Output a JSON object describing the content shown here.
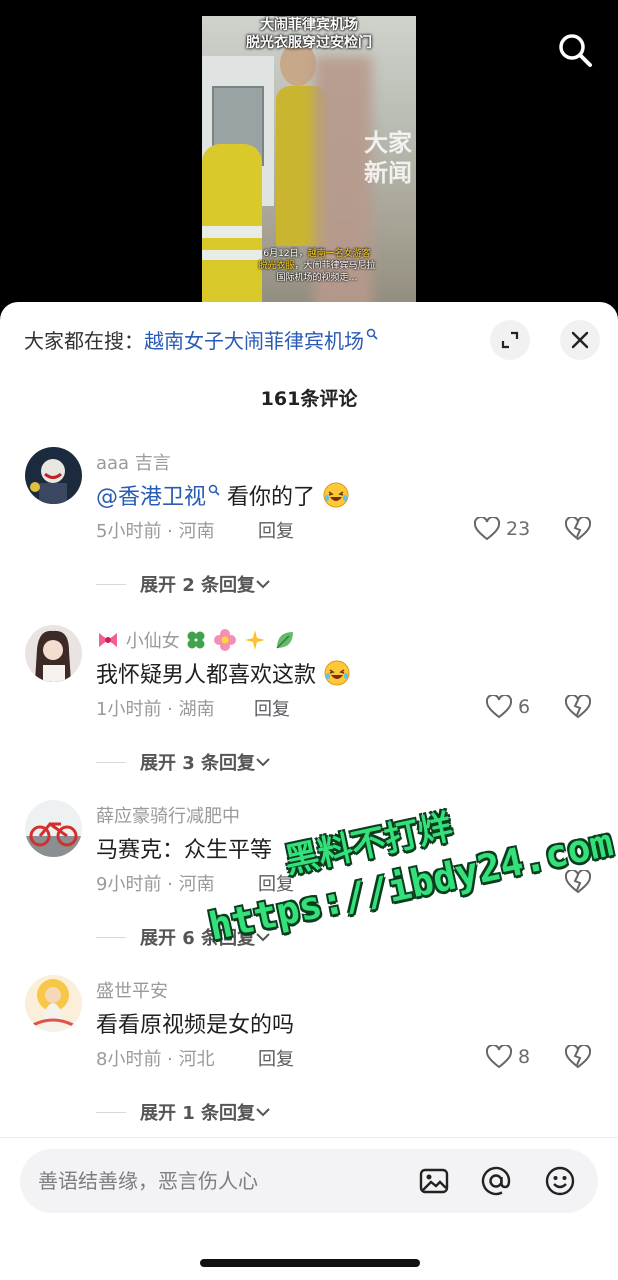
{
  "video": {
    "title_line1": "大闹菲律宾机场",
    "title_line2": "脱光衣服穿过安检门",
    "watermark_line1": "大家",
    "watermark_line2": "新闻",
    "caption_part1": "6月12日，",
    "caption_hl1": "越南一名女游客",
    "caption_hl2": "脱光衣服",
    "caption_part2": "，大闹菲律宾马尼拉",
    "caption_part3": "国际机场的视频走…"
  },
  "sheet": {
    "search_prefix": "大家都在搜：",
    "search_term": "越南女子大闹菲律宾机场",
    "comment_count": "161条评论"
  },
  "comments": [
    {
      "user": "aaa 吉言",
      "mention": "@香港卫视",
      "text": " 看你的了",
      "time_location": "5小时前 · 河南",
      "reply": "回复",
      "likes": "23",
      "expand": "展开 2 条回复"
    },
    {
      "user": "小仙女",
      "text": "我怀疑男人都喜欢这款",
      "time_location": "1小时前 · 湖南",
      "reply": "回复",
      "likes": "6",
      "expand": "展开 3 条回复"
    },
    {
      "user": "薛应豪骑行减肥中",
      "text": "马赛克：众生平等",
      "time_location": "9小时前 · 河南",
      "reply": "回复",
      "likes": "",
      "expand": "展开 6 条回复"
    },
    {
      "user": "盛世平安",
      "text": "看看原视频是女的吗",
      "time_location": "8小时前 · 河北",
      "reply": "回复",
      "likes": "8",
      "expand": "展开 1 条回复"
    }
  ],
  "overlay": {
    "line1": "黑料不打烊",
    "line2": "https://ibdy24.com"
  },
  "input": {
    "placeholder": "善语结善缘，恶言伤人心"
  },
  "colors": {
    "link": "#2a5bb5",
    "overlay_text": "#33e07a"
  }
}
